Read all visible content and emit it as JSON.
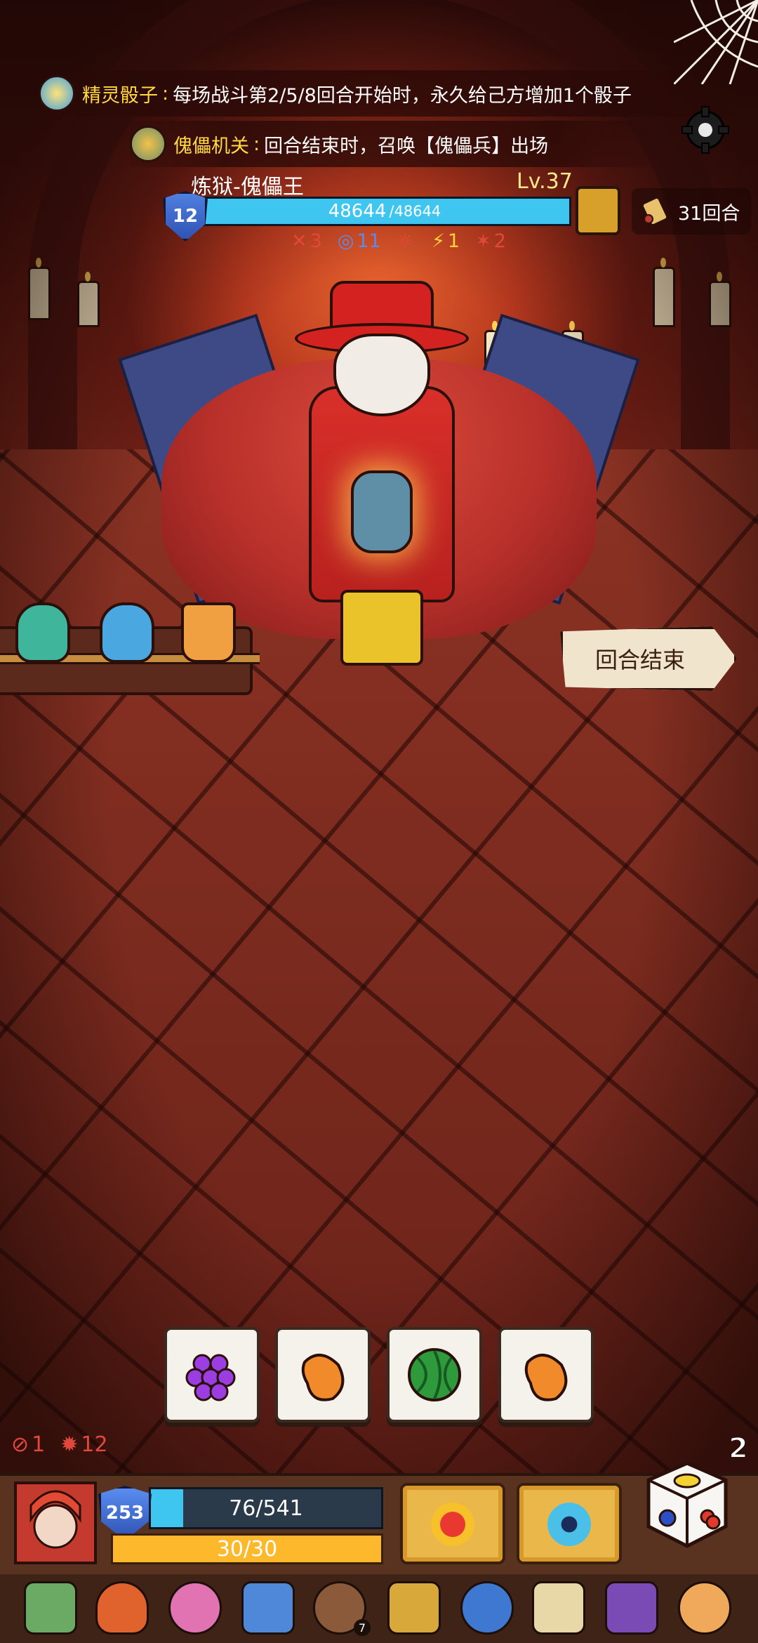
{
  "buffs": [
    {
      "name": "精灵骰子",
      "separator": ":",
      "desc": "每场战斗第2/5/8回合开始时，永久给己方增加1个骰子"
    },
    {
      "name": "傀儡机关",
      "separator": ":",
      "desc": "回合结束时，召唤【傀儡兵】出场"
    }
  ],
  "boss": {
    "name": "炼狱-傀儡王",
    "level": "Lv.37",
    "shield": "12",
    "hp_current": "48644",
    "hp_max": "/48644",
    "hp_fraction": 1.0,
    "statuses": [
      {
        "icon": "attack-icon",
        "value": "3"
      },
      {
        "icon": "vortex-icon",
        "value": "11"
      },
      {
        "icon": "burn-icon",
        "value": ""
      },
      {
        "icon": "lightning-icon",
        "value": "1"
      },
      {
        "icon": "thorn-icon",
        "value": "2"
      }
    ]
  },
  "round": {
    "label": "31回合"
  },
  "end_turn": {
    "label": "回合结束"
  },
  "dice_slots": [
    {
      "icon": "grapes-icon"
    },
    {
      "icon": "mango-icon"
    },
    {
      "icon": "watermelon-icon"
    },
    {
      "icon": "mango-icon"
    }
  ],
  "player": {
    "attack_debuff": "1",
    "burn_value": "12",
    "dice_count": "2",
    "shield": "253",
    "hp": "76/541",
    "hp_fraction": 0.14,
    "energy": "30/30"
  },
  "relics": {
    "badge": "7"
  },
  "colors": {
    "hp_fill": "#3fc6f0",
    "energy_fill": "#fdb92b",
    "buff_name": "#ffd93e",
    "negative": "#e0483c"
  }
}
